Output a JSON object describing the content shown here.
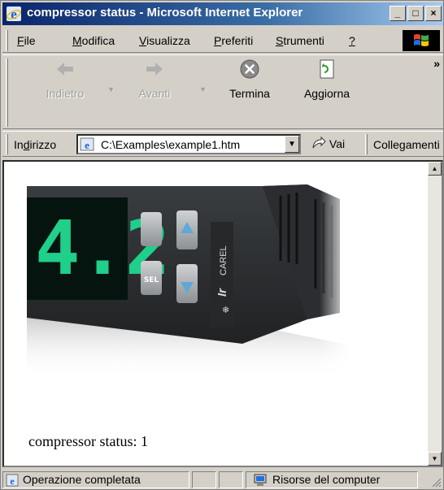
{
  "window": {
    "title": "compressor status - Microsoft Internet Explorer",
    "controls": {
      "minimize": "_",
      "maximize": "□",
      "close": "×"
    }
  },
  "menubar": {
    "items": [
      {
        "prefix": "",
        "underline": "F",
        "rest": "ile"
      },
      {
        "prefix": "",
        "underline": "M",
        "rest": "odifica"
      },
      {
        "prefix": "",
        "underline": "V",
        "rest": "isualizza"
      },
      {
        "prefix": "",
        "underline": "P",
        "rest": "referiti"
      },
      {
        "prefix": "",
        "underline": "S",
        "rest": "trumenti"
      },
      {
        "prefix": "",
        "underline": "?",
        "rest": ""
      }
    ]
  },
  "toolbar": {
    "back_label": "Indietro",
    "forward_label": "Avanti",
    "stop_label": "Termina",
    "refresh_label": "Aggiorna",
    "more": "»"
  },
  "addressbar": {
    "label_prefix": "In",
    "label_underline": "d",
    "label_rest": "irizzo",
    "value": "C:\\Examples\\example1.htm",
    "go_label": "Vai",
    "links_label": "Collegamenti"
  },
  "content": {
    "device": {
      "display": "4.2",
      "brand": "CAREL",
      "model_mark": "Ir"
    },
    "status_text": "compressor status: 1"
  },
  "statusbar": {
    "message": "Operazione completata",
    "zone": "Risorse del computer"
  },
  "colors": {
    "title_start": "#0a246a",
    "title_end": "#a6caf0",
    "chrome": "#d4d0c8",
    "display_green": "#1fcf8a"
  }
}
